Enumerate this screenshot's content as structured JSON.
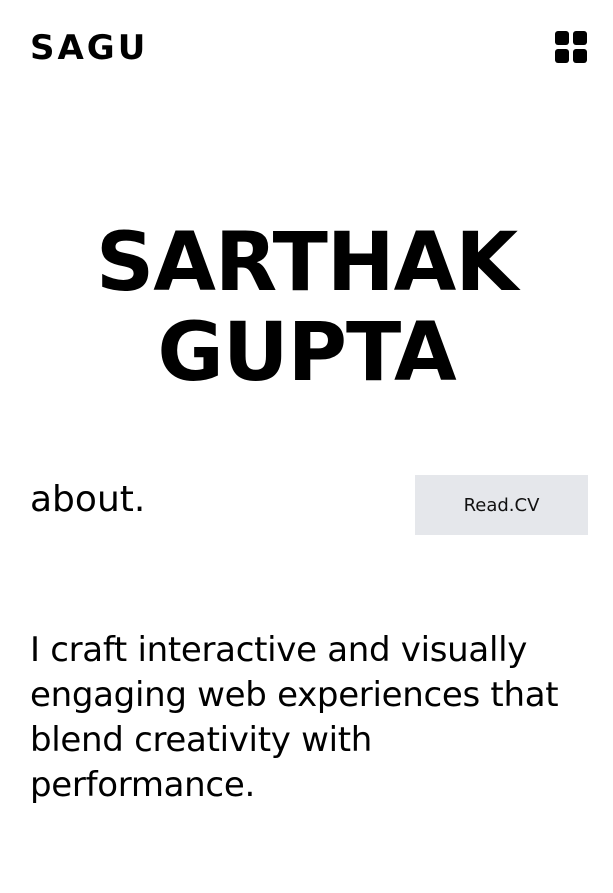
{
  "header": {
    "logo": "SAGU",
    "menu_icon": "grid-menu-icon"
  },
  "hero": {
    "first_name": "SARTHAK",
    "last_name": "GUPTA"
  },
  "about": {
    "title": "about.",
    "cv_button_label": "Read.CV",
    "description": "I craft interactive and visually engaging web experiences that blend creativity with performance."
  },
  "colors": {
    "background": "#ffffff",
    "text": "#000000",
    "button_bg": "#e5e7eb"
  }
}
